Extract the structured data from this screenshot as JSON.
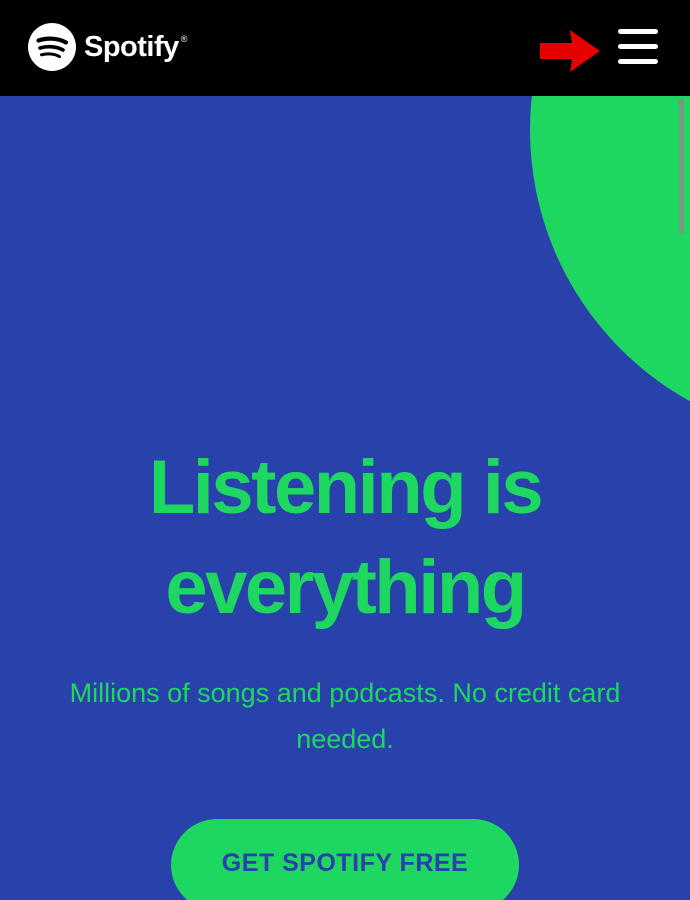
{
  "header": {
    "brand_name": "Spotify",
    "brand_mark": "®",
    "logo_icon": "spotify-logo-icon",
    "menu_icon": "hamburger-menu-icon",
    "annotation_icon": "red-arrow-icon"
  },
  "hero": {
    "headline_line1": "Listening is",
    "headline_line2": "everything",
    "subtitle": "Millions of songs and podcasts. No credit card needed.",
    "cta_label": "GET SPOTIFY FREE"
  },
  "colors": {
    "background": "#2941ab",
    "accent": "#1ed760",
    "header": "#000000",
    "annotation": "#e60000"
  }
}
